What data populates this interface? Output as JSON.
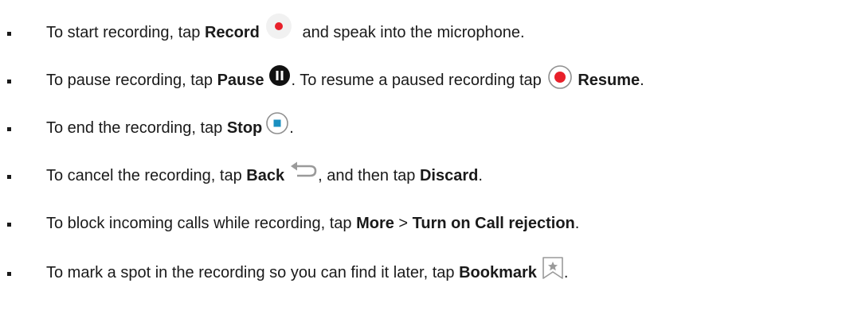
{
  "items": [
    {
      "pre": "To start recording, tap ",
      "b1": "Record",
      "icon": "record-icon",
      "post": " and speak into the microphone."
    },
    {
      "pre": "To pause recording, tap ",
      "b1": "Pause",
      "icon": "pause-icon",
      "mid": ". To resume a paused recording tap ",
      "icon2": "resume-icon",
      "b2": "Resume",
      "post": "."
    },
    {
      "pre": "To end the recording, tap ",
      "b1": "Stop",
      "icon": "stop-icon",
      "post": "."
    },
    {
      "pre": "To cancel the recording, tap ",
      "b1": "Back",
      "icon": "back-arrow-icon",
      "mid": ", and then tap ",
      "b2": "Discard",
      "post": "."
    },
    {
      "pre": "To block incoming calls while recording, tap ",
      "b1": "More",
      "mid": " > ",
      "b2": "Turn on Call rejection",
      "post": "."
    },
    {
      "pre": "To mark a spot in the recording so you can find it later, tap ",
      "b1": "Bookmark",
      "icon": "bookmark-star-icon",
      "post": "."
    }
  ],
  "colors": {
    "record_red": "#e8202a",
    "pause_dark": "#111111",
    "stop_blue": "#1a8fc0",
    "icon_gray": "#9a9a9a"
  }
}
